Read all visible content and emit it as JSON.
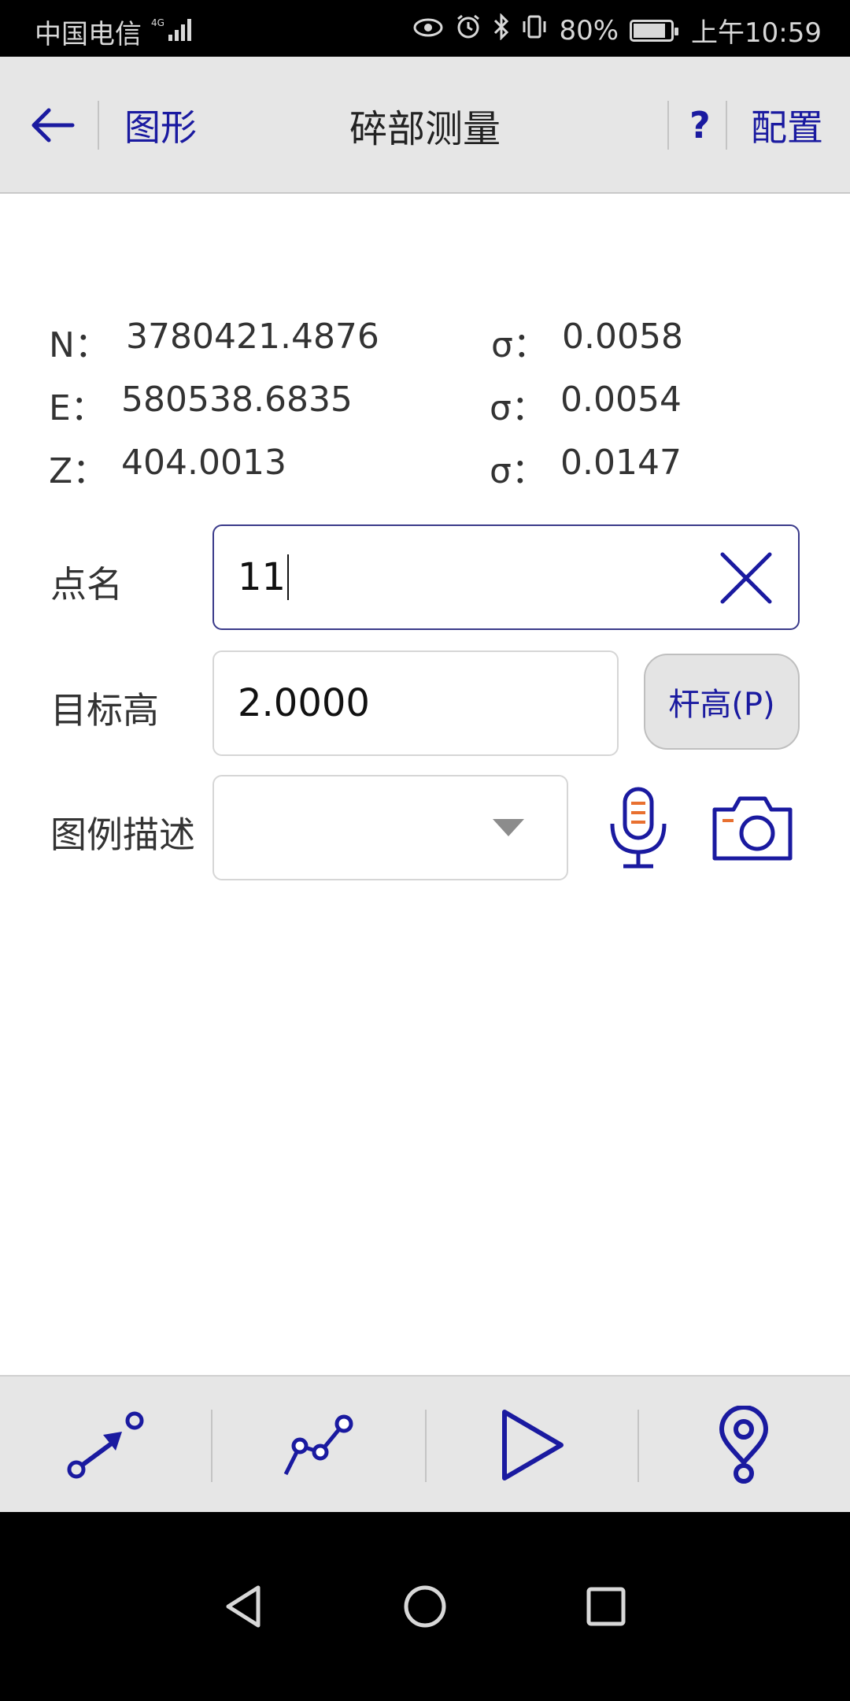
{
  "status_bar": {
    "carrier": "中国电信",
    "network": "4G",
    "battery": "80%",
    "time": "上午10:59"
  },
  "header": {
    "back_icon": "arrow-left-icon",
    "graphics_label": "图形",
    "title": "碎部测量",
    "help_label": "?",
    "config_label": "配置"
  },
  "coordinates": [
    {
      "label": "N：",
      "value": "3780421.4876",
      "sigma_label": "σ：",
      "sigma": "0.0058"
    },
    {
      "label": "E：",
      "value": "580538.6835",
      "sigma_label": "σ：",
      "sigma": "0.0054"
    },
    {
      "label": "Z：",
      "value": "404.0013",
      "sigma_label": "σ：",
      "sigma": "0.0147"
    }
  ],
  "form": {
    "point_name_label": "点名",
    "point_name_value": "11",
    "target_height_label": "目标高",
    "target_height_value": "2.0000",
    "pole_height_button": "杆高(P)",
    "legend_label": "图例描述",
    "legend_value": ""
  },
  "toolbar": {
    "items": [
      "survey-point-icon",
      "polyline-icon",
      "play-icon",
      "location-pin-icon"
    ]
  },
  "navbar": {
    "items": [
      "back-triangle-icon",
      "home-circle-icon",
      "recents-square-icon"
    ]
  },
  "colors": {
    "accent": "#1a1aa0",
    "header_bg": "#e6e6e6",
    "mic_accent": "#e87030"
  }
}
